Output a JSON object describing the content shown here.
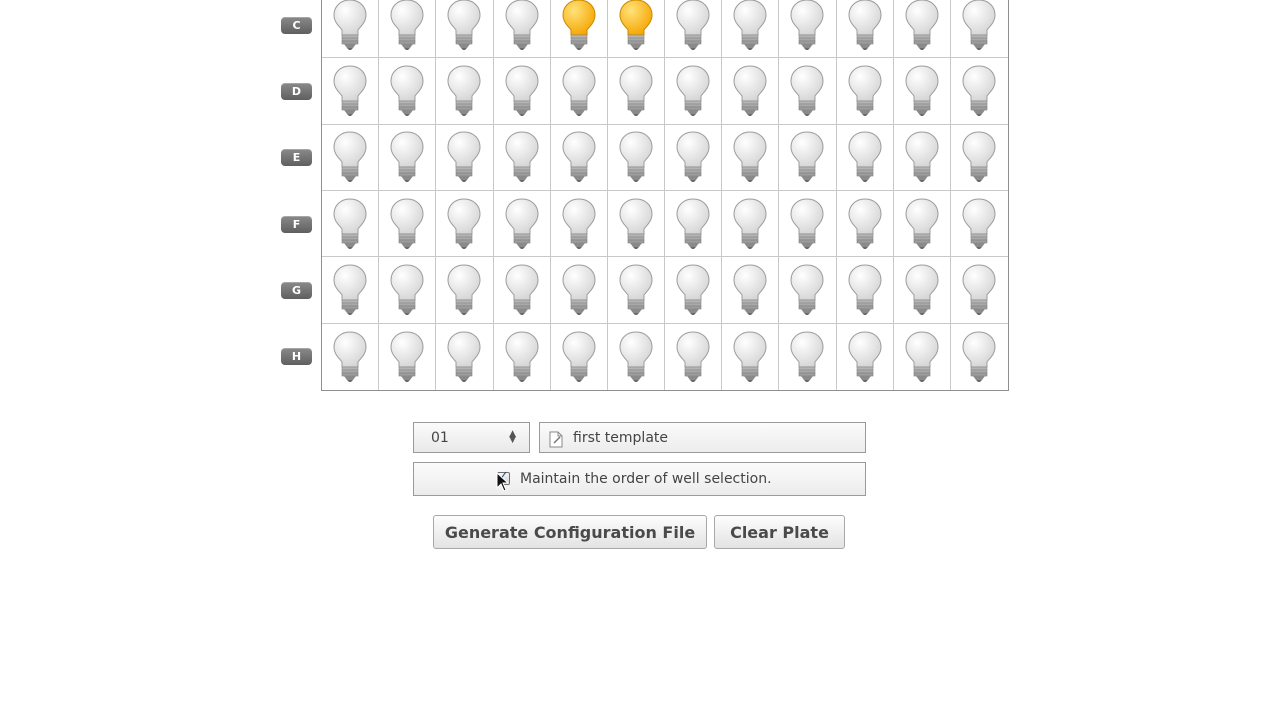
{
  "plate": {
    "rows": [
      {
        "label": "C",
        "lit": [
          false,
          false,
          false,
          false,
          true,
          true,
          false,
          false,
          false,
          false,
          false,
          false
        ]
      },
      {
        "label": "D",
        "lit": [
          false,
          false,
          false,
          false,
          false,
          false,
          false,
          false,
          false,
          false,
          false,
          false
        ]
      },
      {
        "label": "E",
        "lit": [
          false,
          false,
          false,
          false,
          false,
          false,
          false,
          false,
          false,
          false,
          false,
          false
        ]
      },
      {
        "label": "F",
        "lit": [
          false,
          false,
          false,
          false,
          false,
          false,
          false,
          false,
          false,
          false,
          false,
          false
        ]
      },
      {
        "label": "G",
        "lit": [
          false,
          false,
          false,
          false,
          false,
          false,
          false,
          false,
          false,
          false,
          false,
          false
        ]
      },
      {
        "label": "H",
        "lit": [
          false,
          false,
          false,
          false,
          false,
          false,
          false,
          false,
          false,
          false,
          false,
          false
        ]
      }
    ],
    "well_icon": "lightbulb-icon",
    "lit_color": "#f5a500",
    "off_color": "#e6e6e6"
  },
  "controls": {
    "plate_number": "01",
    "template_name": "first template",
    "maintain_order_label": "Maintain the order of well selection.",
    "maintain_order_checked": true
  },
  "buttons": {
    "generate_label": "Generate Configuration File",
    "clear_label": "Clear Plate"
  }
}
